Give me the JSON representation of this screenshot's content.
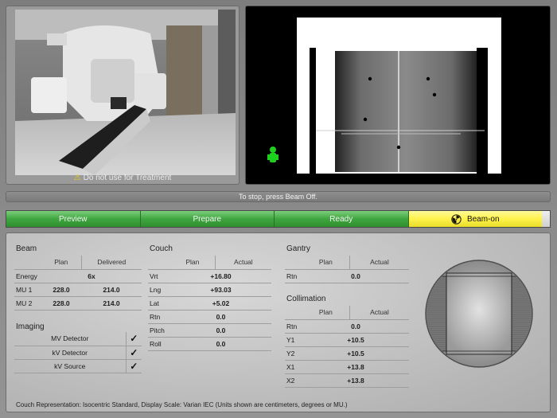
{
  "camera": {
    "warning_icon": "warning-triangle-icon",
    "warning_text": "Do not use for Treatment"
  },
  "status_message": "To stop, press Beam Off.",
  "workflow": {
    "steps": [
      "Preview",
      "Prepare",
      "Ready",
      "Beam-on"
    ],
    "active_index": 3,
    "active_icon": "radiation-icon"
  },
  "beam": {
    "title": "Beam",
    "col_plan": "Plan",
    "col_delivered": "Delivered",
    "energy_label": "Energy",
    "energy_value": "6x",
    "rows": [
      {
        "label": "MU 1",
        "plan": "228.0",
        "delivered": "214.0"
      },
      {
        "label": "MU 2",
        "plan": "228.0",
        "delivered": "214.0"
      }
    ]
  },
  "imaging": {
    "title": "Imaging",
    "rows": [
      {
        "label": "MV Detector",
        "checked": true
      },
      {
        "label": "kV Detector",
        "checked": true
      },
      {
        "label": "kV Source",
        "checked": true
      }
    ],
    "check_glyph": "✓"
  },
  "couch": {
    "title": "Couch",
    "col_plan": "Plan",
    "col_actual": "Actual",
    "rows": [
      {
        "label": "Vrt",
        "value": "+16.80"
      },
      {
        "label": "Lng",
        "value": "+93.03"
      },
      {
        "label": "Lat",
        "value": "+5.02"
      },
      {
        "label": "Rtn",
        "value": "0.0"
      },
      {
        "label": "Pitch",
        "value": "0.0"
      },
      {
        "label": "Roll",
        "value": "0.0"
      }
    ]
  },
  "gantry": {
    "title": "Gantry",
    "col_plan": "Plan",
    "col_actual": "Actual",
    "rows": [
      {
        "label": "Rtn",
        "value": "0.0"
      }
    ]
  },
  "collimation": {
    "title": "Collimation",
    "col_plan": "Plan",
    "col_actual": "Actual",
    "rows": [
      {
        "label": "Rtn",
        "value": "0.0"
      },
      {
        "label": "Y1",
        "value": "+10.5"
      },
      {
        "label": "Y2",
        "value": "+10.5"
      },
      {
        "label": "X1",
        "value": "+13.8"
      },
      {
        "label": "X2",
        "value": "+13.8"
      }
    ]
  },
  "footer_note": "Couch Representation: Isocentric Standard, Display Scale: Varian IEC (Units shown are centimeters, degrees or MU.)",
  "colors": {
    "workflow_green": "#3fa53f",
    "workflow_active_yellow": "#fff24a",
    "patient_marker_green": "#1ed01e"
  }
}
